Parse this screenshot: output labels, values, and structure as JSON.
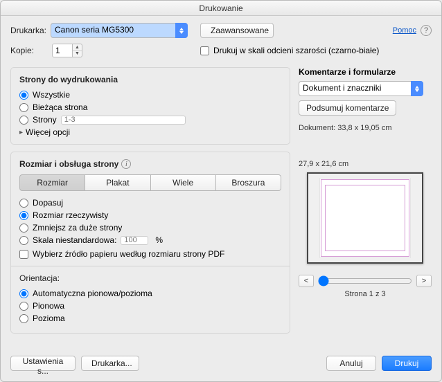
{
  "title": "Drukowanie",
  "help_link": "Pomoc",
  "printer": {
    "label": "Drukarka:",
    "value": "Canon seria MG5300",
    "advanced_btn": "Zaawansowane"
  },
  "copies": {
    "label": "Kopie:",
    "value": "1"
  },
  "grayscale_label": "Drukuj w skali odcieni szarości (czarno-białe)",
  "pages": {
    "title": "Strony do wydrukowania",
    "all": "Wszystkie",
    "current": "Bieżąca strona",
    "pages_label": "Strony",
    "pages_placeholder": "1-3",
    "more": "Więcej opcji"
  },
  "sizing": {
    "title": "Rozmiar i obsługa strony",
    "seg": {
      "size": "Rozmiar",
      "poster": "Plakat",
      "multiple": "Wiele",
      "booklet": "Broszura"
    },
    "fit": "Dopasuj",
    "actual": "Rozmiar rzeczywisty",
    "shrink": "Zmniejsz za duże strony",
    "custom": "Skala niestandardowa:",
    "custom_value": "100",
    "percent": "%",
    "choose_source": "Wybierz źródło papieru według rozmiaru strony PDF"
  },
  "orientation": {
    "title": "Orientacja:",
    "auto": "Automatyczna pionowa/pozioma",
    "portrait": "Pionowa",
    "landscape": "Pozioma"
  },
  "comments": {
    "title": "Komentarze i formularze",
    "select_value": "Dokument i znaczniki",
    "summary_btn": "Podsumuj komentarze"
  },
  "preview": {
    "doc_size": "Dokument: 33,8 x 19,05 cm",
    "paper_size": "27,9 x 21,6 cm",
    "page_indicator": "Strona 1 z 3",
    "prev": "<",
    "next": ">"
  },
  "footer": {
    "page_setup": "Ustawienia s...",
    "printer_btn": "Drukarka...",
    "cancel": "Anuluj",
    "print": "Drukuj"
  }
}
